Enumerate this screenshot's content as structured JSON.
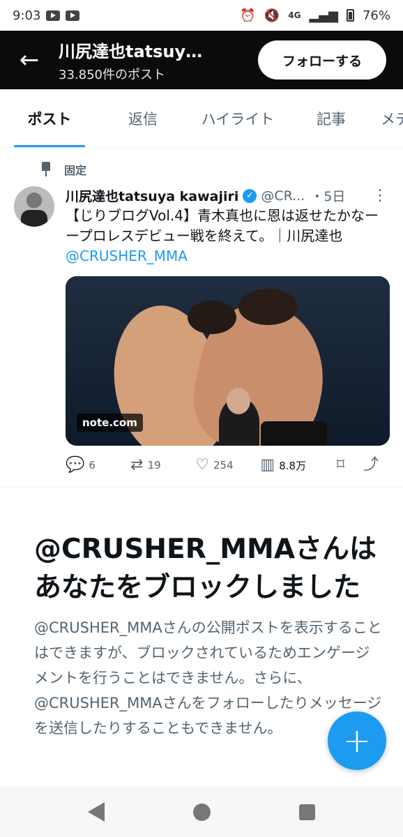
{
  "status": {
    "time": "9:03",
    "network": "4G",
    "battery": "76%",
    "icons": [
      "youtube-icon",
      "youtube-icon",
      "alarm-icon",
      "mute-icon",
      "signal-icon",
      "battery-icon"
    ]
  },
  "header": {
    "title": "川尻達也tatsuy…",
    "subtitle": "33.850件のポスト",
    "follow_label": "フォローする"
  },
  "tabs": [
    {
      "label": "ポスト",
      "active": true
    },
    {
      "label": "返信"
    },
    {
      "label": "ハイライト"
    },
    {
      "label": "記事"
    },
    {
      "label": "メデ"
    }
  ],
  "tweet": {
    "pinned_label": "固定",
    "author": "川尻達也tatsuya kawajiri",
    "handle": "@CR...",
    "date": "・5日",
    "text": "【じりブログVol.4】青木真也に恩は返せたかなーープロレスデビュー戦を終えて。｜川尻達也 ",
    "mention": "@CRUSHER_MMA",
    "card_label": "note.com",
    "metrics": {
      "replies": "6",
      "reposts": "19",
      "likes": "254",
      "views": "8.8万"
    }
  },
  "blocked": {
    "title": "@CRUSHER_MMAさんはあなたをブロックしました",
    "body": "@CRUSHER_MMAさんの公開ポストを表示することはできますが、ブロックされているためエンゲージメントを行うことはできません。さらに、@CRUSHER_MMAさんをフォローしたりメッセージを送信したりすることもできません。"
  },
  "accent": "#1d9bf0",
  "fab_symbol": "+"
}
